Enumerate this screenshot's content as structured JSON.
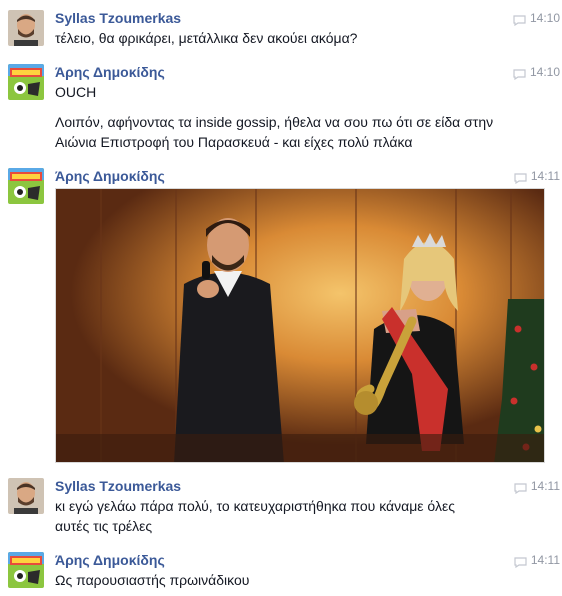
{
  "messages": [
    {
      "sender": "Syllas Tzoumerkas",
      "time": "14:10",
      "lines": [
        "τέλειο, θα φρικάρει,  μετάλλικα δεν ακούει ακόμα?"
      ]
    },
    {
      "sender": "Άρης Δημοκίδης",
      "time": "14:10",
      "lines": [
        "OUCH",
        "Λοιπόν, αφήνοντας τα inside gossip, ήθελα να σου πω ότι σε είδα στην",
        "Αιώνια Επιστροφή του Παρασκευά - και είχες πολύ πλάκα"
      ]
    },
    {
      "sender": "Άρης Δημοκίδης",
      "time": "14:11",
      "attachment": "photo"
    },
    {
      "sender": "Syllas Tzoumerkas",
      "time": "14:11",
      "lines": [
        "κι εγώ γελάω πάρα πολύ, το κατευχαριστήθηκα που κάναμε όλες",
        "αυτές τις τρέλες"
      ]
    },
    {
      "sender": "Άρης Δημοκίδης",
      "time": "14:11",
      "lines": [
        "Ως παρουσιαστής πρωινάδικου"
      ]
    }
  ],
  "colors": {
    "sender_name": "#3b5998",
    "timestamp": "#9197a3",
    "message_text": "#141823"
  },
  "icons": {
    "timestamp": "speech-bubble-icon"
  }
}
